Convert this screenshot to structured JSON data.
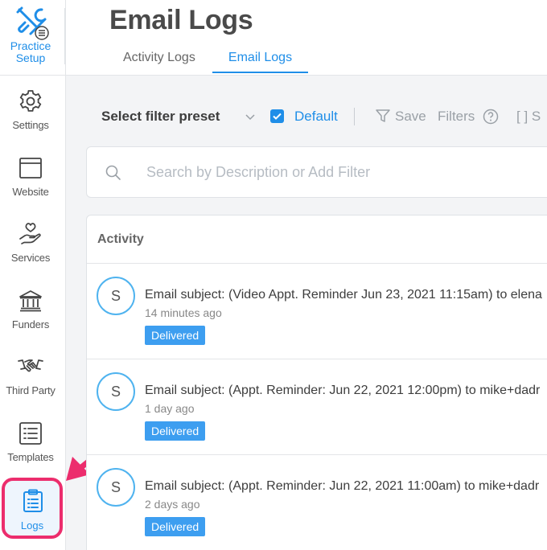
{
  "brand": {
    "label_line1": "Practice",
    "label_line2": "Setup"
  },
  "sidebar": {
    "items": [
      {
        "label": "Settings",
        "icon": "gear-icon"
      },
      {
        "label": "Website",
        "icon": "browser-window-icon"
      },
      {
        "label": "Services",
        "icon": "heart-hand-icon"
      },
      {
        "label": "Funders",
        "icon": "bank-icon"
      },
      {
        "label": "Third Party",
        "icon": "handshake-icon"
      },
      {
        "label": "Templates",
        "icon": "list-icon"
      },
      {
        "label": "Logs",
        "icon": "clipboard-list-icon",
        "active": true
      }
    ]
  },
  "header": {
    "title": "Email Logs",
    "tabs": [
      {
        "label": "Activity Logs",
        "active": false
      },
      {
        "label": "Email Logs",
        "active": true
      }
    ]
  },
  "filter_bar": {
    "preset_label": "Select filter preset",
    "default_label": "Default",
    "default_checked": true,
    "save_label": "Save",
    "filters_label": "Filters",
    "bracket_label": "[ ] S"
  },
  "search": {
    "placeholder": "Search by Description or Add Filter"
  },
  "activity": {
    "header": "Activity",
    "rows": [
      {
        "avatar": "S",
        "subject": "Email subject: (Video Appt. Reminder Jun 23, 2021 11:15am) to elena",
        "time": "14 minutes ago",
        "status": "Delivered"
      },
      {
        "avatar": "S",
        "subject": "Email subject: (Appt. Reminder: Jun 22, 2021 12:00pm) to mike+dadr",
        "time": "1 day ago",
        "status": "Delivered"
      },
      {
        "avatar": "S",
        "subject": "Email subject: (Appt. Reminder: Jun 22, 2021 11:00am) to mike+dadr",
        "time": "2 days ago",
        "status": "Delivered"
      }
    ]
  },
  "colors": {
    "accent": "#1f8ee8",
    "highlight": "#ec2d6d",
    "badge": "#3d9ef0",
    "avatar_ring": "#4fb3ef"
  }
}
